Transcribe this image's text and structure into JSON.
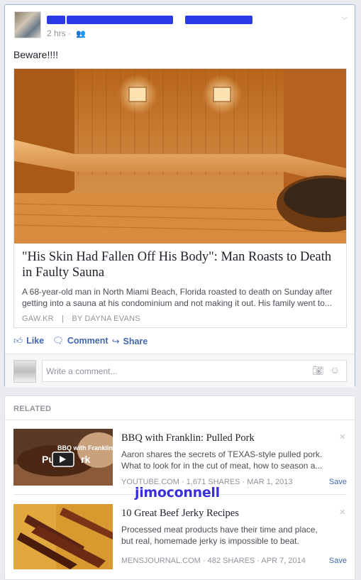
{
  "post": {
    "timestamp": "2 hrs",
    "audience_icon": "friends-icon",
    "text": "Beware!!!!",
    "link": {
      "title": "\"His Skin Had Fallen Off His Body\": Man Roasts to Death in Faulty Sauna",
      "description": "A 68-year-old man in North Miami Beach, Florida roasted to death on Sunday after getting into a sauna at his condominium and not making it out. His family went to...",
      "source": "GAW.KR",
      "separator": "|",
      "byline": "BY DAYNA EVANS"
    },
    "actions": {
      "like": "Like",
      "comment": "Comment",
      "share": "Share"
    },
    "comment_placeholder": "Write a comment..."
  },
  "related": {
    "heading": "RELATED",
    "items": [
      {
        "title": "BBQ with Franklin: Pulled Pork",
        "description": "Aaron shares the secrets of TEXAS-style pulled pork. What to look for in the cut of meat, how to season a...",
        "source": "YOUTUBE.COM · 1,671 SHARES · MAR 1, 2013",
        "save": "Save",
        "close": "×",
        "thumb_text": "BBQ with Franklin Pulled Pork"
      },
      {
        "title": "10 Great Beef Jerky Recipes",
        "description": "Processed meat products have their time and place, but real, homemade jerky is impossible to beat.",
        "source": "MENSJOURNAL.COM · 482 SHARES · APR 7, 2014",
        "save": "Save",
        "close": "×"
      }
    ]
  },
  "watermark": "jimoconnell",
  "colors": {
    "link_blue": "#4267b2",
    "redaction": "#2b3be8"
  }
}
